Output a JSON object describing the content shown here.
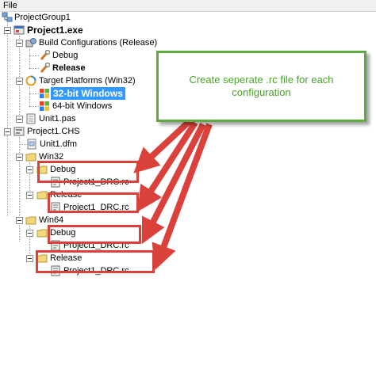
{
  "menu": {
    "file": "File"
  },
  "tree": {
    "group": "ProjectGroup1",
    "project": "Project1.exe",
    "build_configs": "Build Configurations (Release)",
    "debug": "Debug",
    "release": "Release",
    "target_platforms": "Target Platforms (Win32)",
    "win32_selected": "32-bit Windows",
    "win64": "64-bit Windows",
    "unit_pas": "Unit1.pas",
    "chs": "Project1.CHS",
    "unit_dfm": "Unit1.dfm",
    "folder_win32": "Win32",
    "folder_debug_1": "Debug",
    "rc_1": "Project1_DRC.rc",
    "folder_release_1": "Release",
    "rc_2": "Project1_DRC.rc",
    "folder_win64": "Win64",
    "folder_debug_2": "Debug",
    "rc_3": "Project1_DRC.rc",
    "folder_release_2": "Release",
    "rc_4": "Project1_DRC.rc"
  },
  "callout": {
    "text": "Create seperate .rc file for each configuration"
  },
  "colors": {
    "callout_border": "#5cab3c",
    "callout_text": "#4aa329",
    "annotation_red": "#d9413a",
    "selection": "#3399ff"
  }
}
